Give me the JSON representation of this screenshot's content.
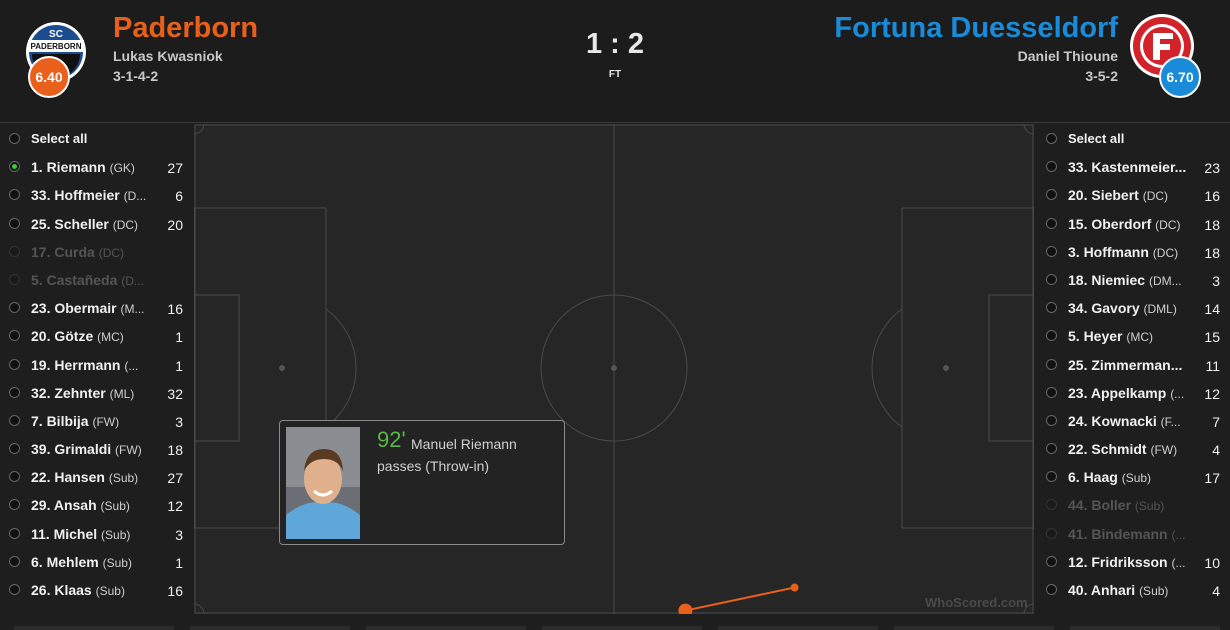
{
  "home": {
    "name": "Paderborn",
    "manager": "Lukas Kwasniok",
    "formation": "3-1-4-2",
    "rating": "6.40",
    "color": "#e8601c",
    "badge_text_top": "SC",
    "badge_text_mid": "PADERBORN"
  },
  "away": {
    "name": "Fortuna Duesseldorf",
    "manager": "Daniel Thioune",
    "formation": "3-5-2",
    "rating": "6.70",
    "color": "#1a8bd8"
  },
  "match": {
    "score": "1 : 2",
    "status": "FT"
  },
  "home_players": {
    "select_all": "Select all",
    "list": [
      {
        "name": "1. Riemann",
        "pos": "(GK)",
        "count": "27",
        "selected": true,
        "dim": false
      },
      {
        "name": "33. Hoffmeier",
        "pos": "(D...",
        "count": "6",
        "selected": false,
        "dim": false
      },
      {
        "name": "25. Scheller",
        "pos": "(DC)",
        "count": "20",
        "selected": false,
        "dim": false
      },
      {
        "name": "17. Curda",
        "pos": "(DC)",
        "count": "",
        "selected": false,
        "dim": true
      },
      {
        "name": "5. Castañeda",
        "pos": "(D...",
        "count": "",
        "selected": false,
        "dim": true
      },
      {
        "name": "23. Obermair",
        "pos": "(M...",
        "count": "16",
        "selected": false,
        "dim": false
      },
      {
        "name": "20. Götze",
        "pos": "(MC)",
        "count": "1",
        "selected": false,
        "dim": false
      },
      {
        "name": "19. Herrmann",
        "pos": "(...",
        "count": "1",
        "selected": false,
        "dim": false
      },
      {
        "name": "32. Zehnter",
        "pos": "(ML)",
        "count": "32",
        "selected": false,
        "dim": false
      },
      {
        "name": "7. Bilbija",
        "pos": "(FW)",
        "count": "3",
        "selected": false,
        "dim": false
      },
      {
        "name": "39. Grimaldi",
        "pos": "(FW)",
        "count": "18",
        "selected": false,
        "dim": false
      },
      {
        "name": "22. Hansen",
        "pos": "(Sub)",
        "count": "27",
        "selected": false,
        "dim": false
      },
      {
        "name": "29. Ansah",
        "pos": "(Sub)",
        "count": "12",
        "selected": false,
        "dim": false
      },
      {
        "name": "11. Michel",
        "pos": "(Sub)",
        "count": "3",
        "selected": false,
        "dim": false
      },
      {
        "name": "6. Mehlem",
        "pos": "(Sub)",
        "count": "1",
        "selected": false,
        "dim": false
      },
      {
        "name": "26. Klaas",
        "pos": "(Sub)",
        "count": "16",
        "selected": false,
        "dim": false
      }
    ]
  },
  "away_players": {
    "select_all": "Select all",
    "list": [
      {
        "name": "33. Kastenmeier...",
        "pos": "",
        "count": "23",
        "selected": false,
        "dim": false
      },
      {
        "name": "20. Siebert",
        "pos": "(DC)",
        "count": "16",
        "selected": false,
        "dim": false
      },
      {
        "name": "15. Oberdorf",
        "pos": "(DC)",
        "count": "18",
        "selected": false,
        "dim": false
      },
      {
        "name": "3. Hoffmann",
        "pos": "(DC)",
        "count": "18",
        "selected": false,
        "dim": false
      },
      {
        "name": "18. Niemiec",
        "pos": "(DM...",
        "count": "3",
        "selected": false,
        "dim": false
      },
      {
        "name": "34. Gavory",
        "pos": "(DML)",
        "count": "14",
        "selected": false,
        "dim": false
      },
      {
        "name": "5. Heyer",
        "pos": "(MC)",
        "count": "15",
        "selected": false,
        "dim": false
      },
      {
        "name": "25. Zimmerman...",
        "pos": "",
        "count": "11",
        "selected": false,
        "dim": false
      },
      {
        "name": "23. Appelkamp",
        "pos": "(...",
        "count": "12",
        "selected": false,
        "dim": false
      },
      {
        "name": "24. Kownacki",
        "pos": "(F...",
        "count": "7",
        "selected": false,
        "dim": false
      },
      {
        "name": "22. Schmidt",
        "pos": "(FW)",
        "count": "4",
        "selected": false,
        "dim": false
      },
      {
        "name": "6. Haag",
        "pos": "(Sub)",
        "count": "17",
        "selected": false,
        "dim": false
      },
      {
        "name": "44. Boller",
        "pos": "(Sub)",
        "count": "",
        "selected": false,
        "dim": true
      },
      {
        "name": "41. Bindemann",
        "pos": "(...",
        "count": "",
        "selected": false,
        "dim": true
      },
      {
        "name": "12. Fridriksson",
        "pos": "(...",
        "count": "10",
        "selected": false,
        "dim": false
      },
      {
        "name": "40. Anhari",
        "pos": "(Sub)",
        "count": "4",
        "selected": false,
        "dim": false
      }
    ]
  },
  "tooltip": {
    "minute": "92'",
    "text": "Manuel Riemann passes (Throw-in)"
  },
  "pass": {
    "from": [
      0.585,
      0.993
    ],
    "to": [
      0.715,
      0.946
    ],
    "color": "#e8601c"
  },
  "watermark": "WhoScored.com"
}
